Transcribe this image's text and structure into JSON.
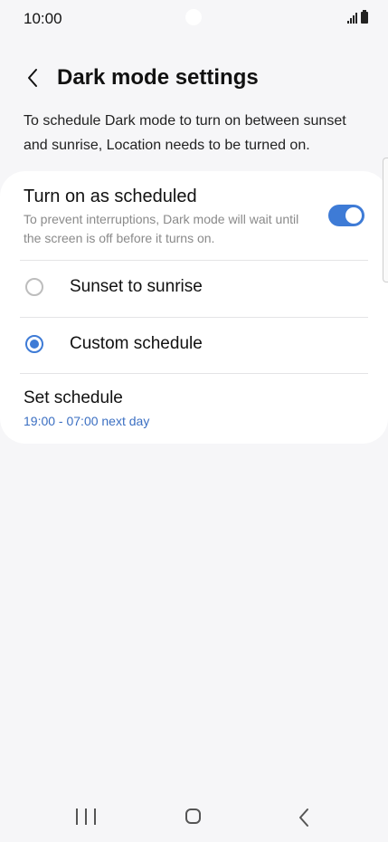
{
  "status_bar": {
    "time": "10:00"
  },
  "header": {
    "title": "Dark mode settings",
    "back_icon": "chevron-left-icon"
  },
  "description": "To schedule Dark mode to turn on between sunset and sunrise, Location needs to be turned on.",
  "settings": {
    "scheduled": {
      "title": "Turn on as scheduled",
      "subtitle": "To prevent interruptions, Dark mode will wait until the screen is off before it turns on.",
      "enabled": true
    },
    "options": [
      {
        "label": "Sunset to sunrise",
        "selected": false
      },
      {
        "label": "Custom schedule",
        "selected": true
      }
    ],
    "schedule": {
      "title": "Set schedule",
      "value": "19:00 - 07:00 next day"
    }
  },
  "colors": {
    "accent": "#3e7bd6",
    "background": "#f6f6f8",
    "card": "#ffffff",
    "link": "#3b6fc2"
  },
  "nav_bar": {
    "icons": [
      "recents-icon",
      "home-icon",
      "back-icon"
    ]
  }
}
